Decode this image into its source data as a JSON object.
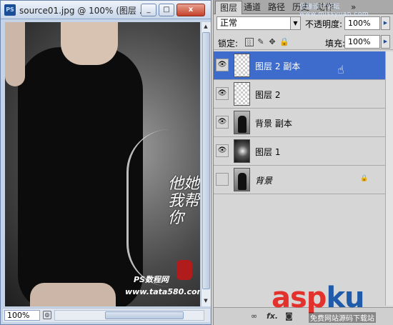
{
  "document_window": {
    "app_icon": "PS",
    "title": "source01.jpg @ 100% (图层 ...",
    "zoom": "100%",
    "controls": [
      "_",
      "□",
      "x"
    ]
  },
  "canvas_watermarks": {
    "calligraphy": "他她我帮你",
    "line1": "PS数程网",
    "line2": "www.tata580.com"
  },
  "panel": {
    "tabs": [
      "图层",
      "通道",
      "路径",
      "历史",
      "动作",
      "»"
    ],
    "top_watermark": "思缘设计论坛 www.missyuan.com",
    "blend_mode": "正常",
    "opacity_label": "不透明度:",
    "opacity_value": "100%",
    "lock_label": "锁定:",
    "fill_label": "填充:",
    "fill_value": "100%",
    "layers": [
      {
        "name": "图层 2 副本",
        "thumb": "transparent",
        "visible": true,
        "selected": true
      },
      {
        "name": "图层 2",
        "thumb": "transparent",
        "visible": true,
        "selected": false
      },
      {
        "name": "背景 副本",
        "thumb": "photo",
        "visible": true,
        "selected": false
      },
      {
        "name": "图层 1",
        "thumb": "gradient",
        "visible": true,
        "selected": false
      },
      {
        "name": "背景",
        "thumb": "photo",
        "visible": false,
        "selected": false,
        "locked": true
      }
    ],
    "bottom_icons": [
      "link-icon",
      "fx-icon",
      "mask-icon"
    ],
    "bottom_labels": {
      "link": "∞",
      "fx": "fx.",
      "mask": "◙"
    }
  },
  "logo": {
    "red": "asp",
    "blue": "ku",
    "suffix": ".com",
    "subtitle": "免费网站源码下载站"
  },
  "icons": {
    "eye": "👁",
    "lock": "🔒",
    "brush": "✎",
    "move": "✥",
    "hand": "☝"
  }
}
